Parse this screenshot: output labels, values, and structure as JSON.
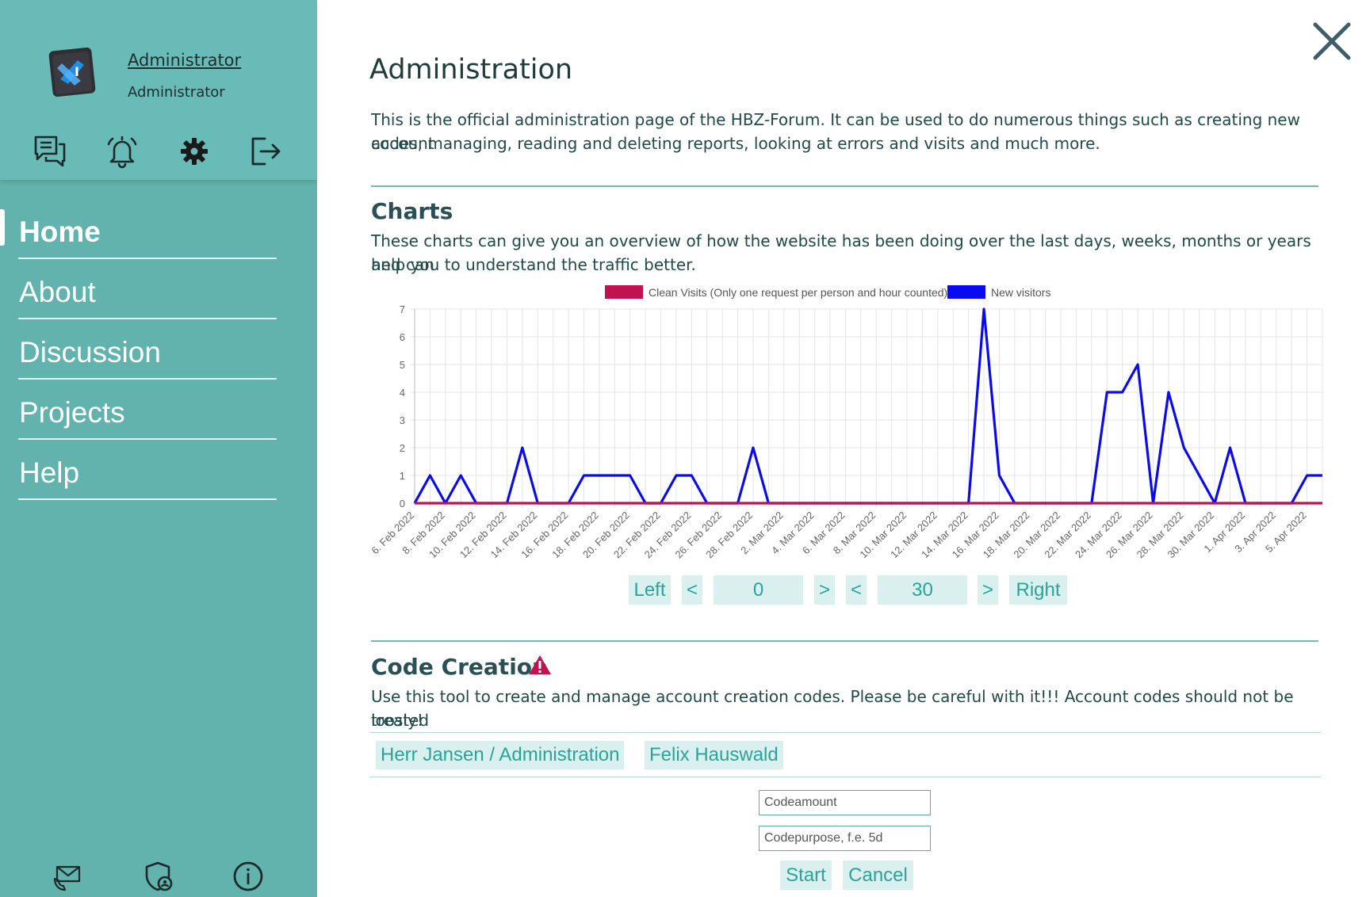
{
  "user": {
    "name": "Administrator",
    "role": "Administrator"
  },
  "quick_icons": [
    "chat-icon",
    "bell-icon",
    "gear-icon",
    "logout-icon"
  ],
  "nav": {
    "items": [
      {
        "label": "Home",
        "active": true
      },
      {
        "label": "About",
        "active": false
      },
      {
        "label": "Discussion",
        "active": false
      },
      {
        "label": "Projects",
        "active": false
      },
      {
        "label": "Help",
        "active": false
      }
    ]
  },
  "bottom_icons": [
    "mail-icon",
    "shield-user-icon",
    "info-icon"
  ],
  "page": {
    "title": "Administration",
    "intro_line1": "This is the official administration page of the HBZ-Forum. It can be used to do numerous things such as creating new account",
    "intro_line2": "codes, managing, reading and deleting reports, looking at errors and visits and much more."
  },
  "charts_section": {
    "title": "Charts",
    "desc_line1": "These charts can give you an overview of how the website has been doing over the last days, weeks, months or years and can",
    "desc_line2": "help you to understand the traffic better."
  },
  "chart_data": {
    "type": "line",
    "title": "",
    "xlabel": "",
    "ylabel": "",
    "ylim": [
      0,
      7
    ],
    "yticks": [
      0,
      1,
      2,
      3,
      4,
      5,
      6,
      7
    ],
    "grid": true,
    "legend": "top-center",
    "x": [
      "6. Feb 2022",
      "7. Feb 2022",
      "8. Feb 2022",
      "9. Feb 2022",
      "10. Feb 2022",
      "11. Feb 2022",
      "12. Feb 2022",
      "13. Feb 2022",
      "14. Feb 2022",
      "15. Feb 2022",
      "16. Feb 2022",
      "17. Feb 2022",
      "18. Feb 2022",
      "19. Feb 2022",
      "20. Feb 2022",
      "21. Feb 2022",
      "22. Feb 2022",
      "23. Feb 2022",
      "24. Feb 2022",
      "25. Feb 2022",
      "26. Feb 2022",
      "27. Feb 2022",
      "28. Feb 2022",
      "1. Mar 2022",
      "2. Mar 2022",
      "3. Mar 2022",
      "4. Mar 2022",
      "5. Mar 2022",
      "6. Mar 2022",
      "7. Mar 2022",
      "8. Mar 2022",
      "9. Mar 2022",
      "10. Mar 2022",
      "11. Mar 2022",
      "12. Mar 2022",
      "13. Mar 2022",
      "14. Mar 2022",
      "15. Mar 2022",
      "16. Mar 2022",
      "17. Mar 2022",
      "18. Mar 2022",
      "19. Mar 2022",
      "20. Mar 2022",
      "21. Mar 2022",
      "22. Mar 2022",
      "23. Mar 2022",
      "24. Mar 2022",
      "25. Mar 2022",
      "26. Mar 2022",
      "27. Mar 2022",
      "28. Mar 2022",
      "29. Mar 2022",
      "30. Mar 2022",
      "31. Mar 2022",
      "1. Apr 2022",
      "2. Apr 2022",
      "3. Apr 2022",
      "4. Apr 2022",
      "5. Apr 2022",
      "6. Apr 2022"
    ],
    "tick_labels": [
      "6. Feb 2022",
      "8. Feb 2022",
      "10. Feb 2022",
      "12. Feb 2022",
      "14. Feb 2022",
      "16. Feb 2022",
      "18. Feb 2022",
      "20. Feb 2022",
      "22. Feb 2022",
      "24. Feb 2022",
      "26. Feb 2022",
      "28. Feb 2022",
      "2. Mar 2022",
      "4. Mar 2022",
      "6. Mar 2022",
      "8. Mar 2022",
      "10. Mar 2022",
      "12. Mar 2022",
      "14. Mar 2022",
      "16. Mar 2022",
      "18. Mar 2022",
      "20. Mar 2022",
      "22. Mar 2022",
      "24. Mar 2022",
      "26. Mar 2022",
      "28. Mar 2022",
      "30. Mar 2022",
      "1. Apr 2022",
      "3. Apr 2022",
      "5. Apr 2022"
    ],
    "series": [
      {
        "name": "Clean Visits (Only one request per person and hour counted)",
        "color": "#c0124f",
        "values": [
          0,
          0,
          0,
          0,
          0,
          0,
          0,
          0,
          0,
          0,
          0,
          0,
          0,
          0,
          0,
          0,
          0,
          0,
          0,
          0,
          0,
          0,
          0,
          0,
          0,
          0,
          0,
          0,
          0,
          0,
          0,
          0,
          0,
          0,
          0,
          0,
          0,
          0,
          0,
          0,
          0,
          0,
          0,
          0,
          0,
          0,
          0,
          0,
          0,
          0,
          0,
          0,
          0,
          0,
          0,
          0,
          0,
          0,
          0,
          0
        ]
      },
      {
        "name": "New visitors",
        "color": "#0a0aee",
        "values": [
          0,
          1,
          0,
          1,
          0,
          0,
          0,
          2,
          0,
          0,
          0,
          1,
          1,
          1,
          1,
          0,
          0,
          1,
          1,
          0,
          0,
          0,
          2,
          0,
          0,
          0,
          0,
          0,
          0,
          0,
          0,
          0,
          0,
          0,
          0,
          0,
          0,
          7,
          1,
          0,
          0,
          0,
          0,
          0,
          0,
          4,
          4,
          5,
          0,
          4,
          2,
          1,
          0,
          2,
          0,
          0,
          0,
          0,
          1,
          1
        ]
      }
    ]
  },
  "chart_controls": {
    "left": "Left",
    "prev1": "<",
    "start": "0",
    "next1": ">",
    "prev2": "<",
    "range": "30",
    "next2": ">",
    "right": "Right"
  },
  "code_section": {
    "title": "Code Creation",
    "desc_line1": "Use this tool to create and manage account creation codes. Please be careful with it!!! Account codes should not be treated",
    "desc_line2": "loosly!",
    "tabs": [
      "Herr Jansen / Administration",
      "Felix Hauswald"
    ],
    "codeamount_placeholder": "Codeamount",
    "codepurpose_placeholder": "Codepurpose, f.e. 5d",
    "start": "Start",
    "cancel": "Cancel"
  },
  "colors": {
    "sidebar": "#62b3ad",
    "accent": "#2aa39a",
    "button_bg": "#d9f0ee",
    "warning": "#c0124f"
  }
}
